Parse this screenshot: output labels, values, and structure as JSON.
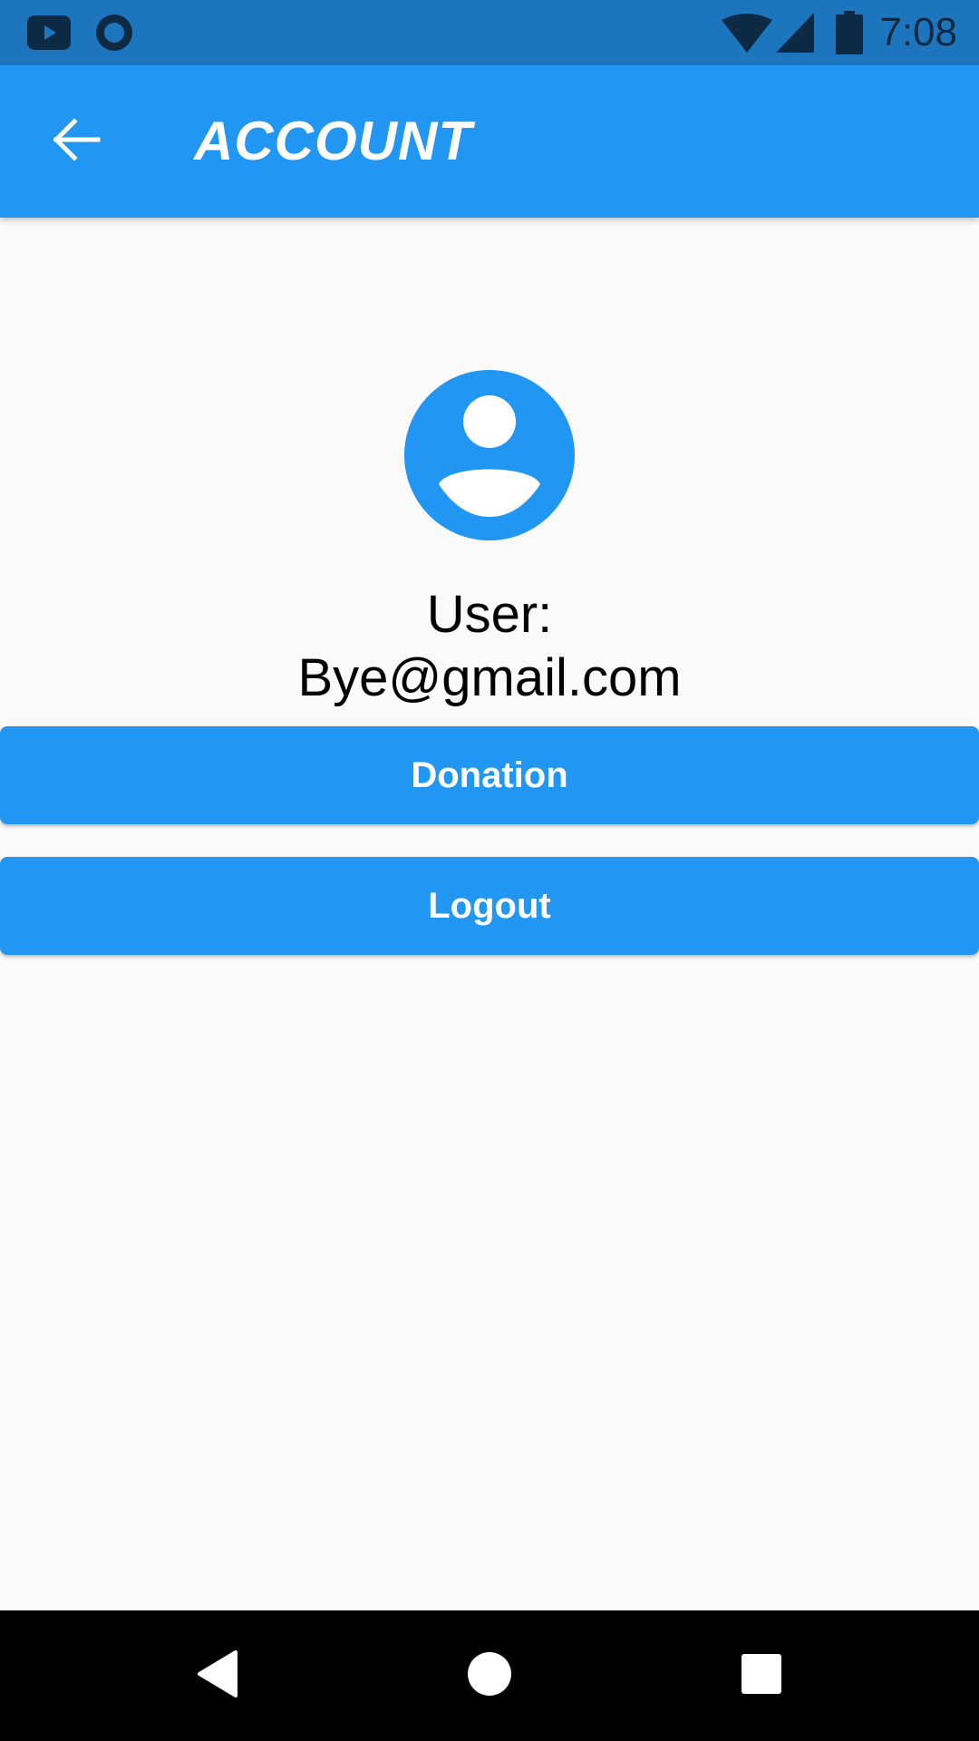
{
  "status_bar": {
    "time": "7:08",
    "left_icons": [
      "youtube-icon",
      "record-icon"
    ],
    "right_icons": [
      "wifi-icon",
      "signal-icon",
      "battery-icon"
    ]
  },
  "app_bar": {
    "title": "ACCOUNT",
    "back_icon": "arrow-back-icon",
    "color": "#2196f3"
  },
  "profile": {
    "avatar_icon": "account-circle-icon",
    "user_label": "User:",
    "email": "Bye@gmail.com"
  },
  "buttons": {
    "donation_label": "Donation",
    "logout_label": "Logout"
  },
  "nav_bar": {
    "icons": [
      "back-triangle-icon",
      "home-circle-icon",
      "recents-square-icon"
    ]
  }
}
